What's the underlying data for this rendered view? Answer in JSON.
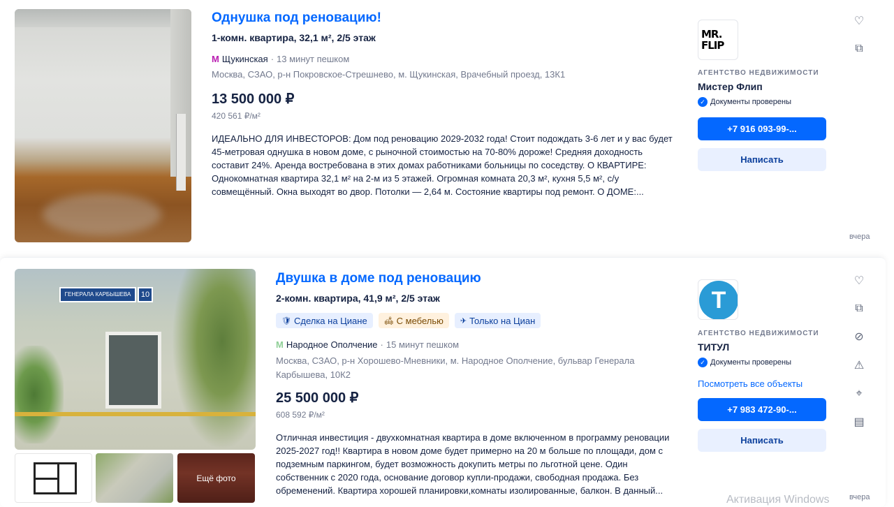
{
  "listings": [
    {
      "title": "Однушка под реновацию!",
      "subtitle": "1-комн. квартира, 32,1 м², 2/5 этаж",
      "metro_icon": "М",
      "metro_color": "#b91eb1",
      "metro": "Щукинская",
      "walk": "13 минут пешком",
      "address": "Москва, СЗАО, р-н Покровское-Стрешнево, м. Щукинская, Врачебный проезд, 13К1",
      "price": "13 500 000 ₽",
      "price_per_m": "420 561 ₽/м²",
      "description": "ИДЕАЛЬНО ДЛЯ ИНВЕСТОРОВ: Дом под реновацию 2029-2032 года! Стоит подождать 3-6 лет и у вас будет 45-метровая однушка в новом доме, с рыночной стоимостью на 70-80% дороже! Средняя доходность составит 24%. Аренда востребована в этих домах работниками больницы по соседству. О КВАРТИРЕ: Однокомнатная квартира 32,1 м² на 2-м из 5 этажей. Огромная комната 20,3 м², кухня 5,5 м², с/у совмещённый. Окна выходят во двор. Потолки — 2,64 м. Состояние квартиры под ремонт. О ДОМЕ:...",
      "agency_logo_text": "MR.\nFLIP",
      "agency_label": "АГЕНТСТВО НЕДВИЖИМОСТИ",
      "agency_name": "Мистер Флип",
      "verified": "Документы проверены",
      "phone": "+7 916 093-99-...",
      "write": "Написать",
      "date": "вчера"
    },
    {
      "title": "Двушка в доме под реновацию",
      "subtitle": "2-комн. квартира, 41,9 м², 2/5 этаж",
      "badges": [
        {
          "icon": "shield-icon",
          "glyph": "🛡",
          "label": "Сделка на Циане",
          "style": "blue"
        },
        {
          "icon": "sofa-icon",
          "glyph": "🛋",
          "label": "С мебелью",
          "style": "orange"
        },
        {
          "icon": "rocket-icon",
          "glyph": "✈",
          "label": "Только на Циан",
          "style": "blue"
        }
      ],
      "metro_icon": "М",
      "metro_color": "#8fcf97",
      "metro": "Народное Ополчение",
      "walk": "15 минут пешком",
      "address": "Москва, СЗАО, р-н Хорошево-Мневники, м. Народное Ополчение, бульвар Генерала Карбышева, 10К2",
      "price": "25 500 000 ₽",
      "price_per_m": "608 592 ₽/м²",
      "description": "Отличная инвестиция - двухкомнатная квартира в доме включенном в программу реновации 2025-2027 год!! Квартира в новом доме будет примерно на 20 м больше по площади, дом с подземным паркингом, будет возможность докупить метры по льготной цене. Один собственник с 2020 года, основание договор купли-продажи, свободная продажа. Без обременений. Квартира хорошей планировки,комнаты изолированные, балкон. В данный...",
      "photo_sign_text": "ГЕНЕРАЛА КАРБЫШЕВА",
      "photo_house_number": "10",
      "more_photos": "Ещё фото",
      "agency_logo_text": "Т",
      "agency_label": "АГЕНТСТВО НЕДВИЖИМОСТИ",
      "agency_name": "ТИТУЛ",
      "verified": "Документы проверены",
      "see_all": "Посмотреть все объекты",
      "phone": "+7 983 472-90-...",
      "write": "Написать",
      "date": "вчера"
    }
  ],
  "watermark": "Активация Windows"
}
